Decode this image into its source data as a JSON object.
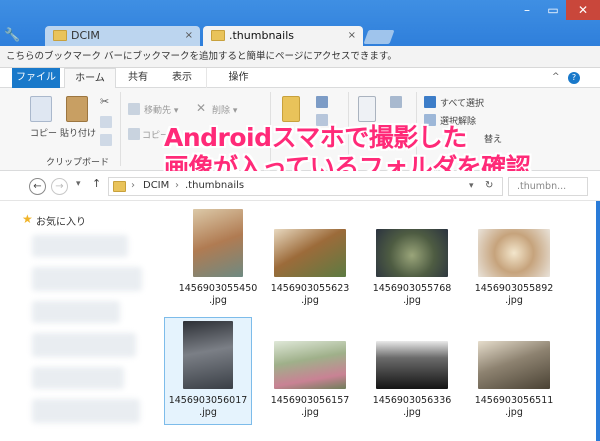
{
  "browser": {
    "tabs": [
      {
        "label": "DCIM",
        "active": false
      },
      {
        "label": ".thumbnails",
        "active": true
      }
    ],
    "tab_close": "×",
    "window_controls": {
      "minimize": "–",
      "maximize": "▭",
      "close": "✕"
    }
  },
  "bookmark_bar": {
    "text": "こちらのブックマーク バーにブックマークを追加すると簡単にページにアクセスできます。"
  },
  "ribbon": {
    "tabs": [
      "ファイル",
      "ホーム",
      "共有",
      "表示",
      "操作"
    ],
    "groups": {
      "clipboard": {
        "copy": "コピー",
        "paste": "貼り付け",
        "name": "クリップボード"
      },
      "organize": {
        "move_to": "移動先 ▾",
        "delete": "削除 ▾",
        "copy_to": "コピー"
      },
      "select": {
        "select_all": "すべて選択",
        "select_none": "選択解除",
        "invert": "替え"
      }
    },
    "controls": {
      "collapse": "^",
      "help": "?"
    }
  },
  "caption": {
    "line1": "Androidスマホで撮影した",
    "line2": "画像が入っているフォルダを確認"
  },
  "address_bar": {
    "back": "←",
    "forward": "→",
    "dropdown": "▾",
    "up": "↑",
    "separator": "›",
    "crumbs": [
      "DCIM",
      ".thumbnails"
    ],
    "refresh": "↻",
    "address_dropdown": "▾",
    "search_placeholder": ".thumbn..."
  },
  "nav_pane": {
    "favorites": "お気に入り"
  },
  "files": [
    {
      "name": "1456903055450",
      "ext": ".jpg",
      "selected": false,
      "color": "#b89472"
    },
    {
      "name": "1456903055623",
      "ext": ".jpg",
      "selected": false,
      "color": "#c7a27a"
    },
    {
      "name": "1456903055768",
      "ext": ".jpg",
      "selected": false,
      "color": "#4d5a4a"
    },
    {
      "name": "1456903055892",
      "ext": ".jpg",
      "selected": false,
      "color": "#cdb89c"
    },
    {
      "name": "1456903056017",
      "ext": ".jpg",
      "selected": true,
      "color": "#4a4f56"
    },
    {
      "name": "1456903056157",
      "ext": ".jpg",
      "selected": false,
      "color": "#b3bf9a"
    },
    {
      "name": "1456903056336",
      "ext": ".jpg",
      "selected": false,
      "color": "#2b2b2b"
    },
    {
      "name": "1456903056511",
      "ext": ".jpg",
      "selected": false,
      "color": "#a7a091"
    }
  ]
}
